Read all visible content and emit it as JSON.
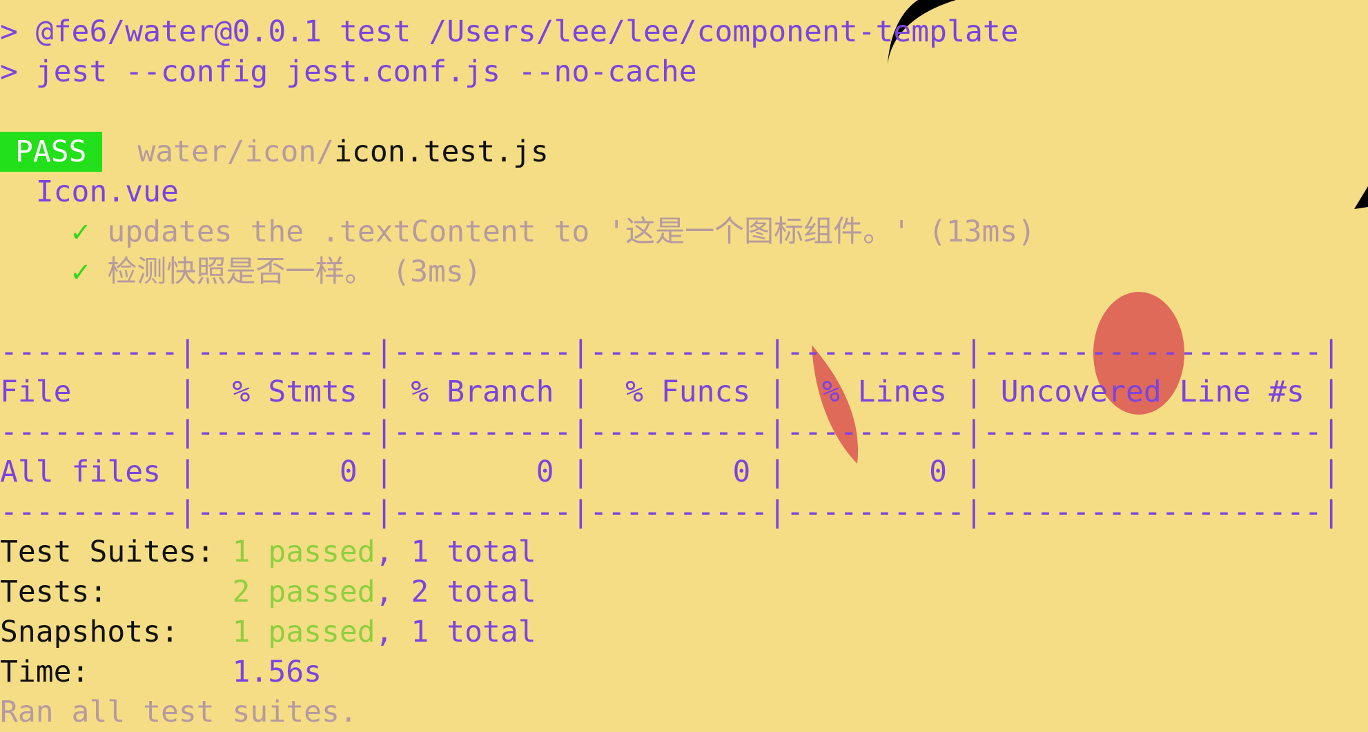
{
  "header": {
    "line1": "> @fe6/water@0.0.1 test /Users/lee/lee/component-template",
    "line2": "> jest --config jest.conf.js --no-cache"
  },
  "result": {
    "badge": "PASS",
    "path_dir": "water/icon/",
    "path_file": "icon.test.js",
    "suite_name": "Icon.vue",
    "tests": [
      {
        "check": "✓",
        "text": "updates the .textContent to '这是一个图标组件。' (13ms)"
      },
      {
        "check": "✓",
        "text": "检测快照是否一样。 (3ms)"
      }
    ]
  },
  "coverage": {
    "separator": "----------|----------|----------|----------|----------|-------------------|",
    "header_row": "File      |  % Stmts | % Branch |  % Funcs |  % Lines | Uncovered Line #s |",
    "data_row": "All files |        0 |        0 |        0 |        0 |                   |"
  },
  "summary": [
    {
      "label": "Test Suites: ",
      "passed": "1 passed",
      "rest": ", 1 total"
    },
    {
      "label": "Tests:       ",
      "passed": "2 passed",
      "rest": ", 2 total"
    },
    {
      "label": "Snapshots:   ",
      "passed": "1 passed",
      "rest": ", 1 total"
    },
    {
      "label": "Time:        ",
      "passed": "",
      "rest": "1.56s"
    }
  ],
  "footer": "Ran all test suites.",
  "colors": {
    "background": "#f5dd85",
    "purple": "#7b44e0",
    "pass_badge": "#22e01a",
    "green": "#8fcf3e",
    "gray": "#b79aa0",
    "decor_red": "#e06a5a"
  }
}
